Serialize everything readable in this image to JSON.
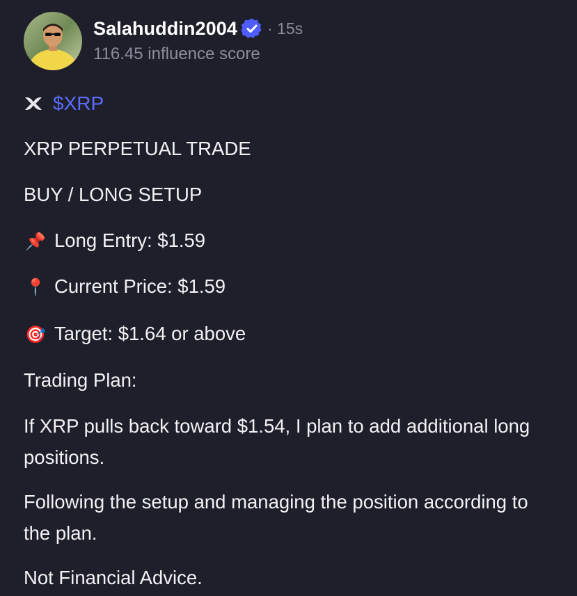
{
  "author": {
    "username": "Salahuddin2004",
    "verified": true,
    "time_ago": "· 15s",
    "influence_score": "116.45 influence score"
  },
  "post": {
    "cashtag": "$XRP",
    "cashtag_icon": "xrp-logo-icon",
    "title": "XRP PERPETUAL TRADE",
    "setup": "BUY / LONG SETUP",
    "entry": {
      "icon": "pushpin-icon",
      "glyph": "📌",
      "text": "Long Entry: $1.59"
    },
    "current": {
      "icon": "round-pin-icon",
      "glyph": "📍",
      "text": "Current Price: $1.59"
    },
    "target": {
      "icon": "target-icon",
      "glyph": "🎯",
      "text": "Target: $1.64 or above"
    },
    "plan_heading": "Trading Plan:",
    "plan_text": "If XRP pulls back toward $1.54, I plan to add additional long positions.",
    "follow_text": "Following the setup and managing the position according to the plan.",
    "disclaimer": "Not Financial Advice."
  },
  "colors": {
    "background": "#1f1f2b",
    "cashtag": "#5b6cff",
    "verified_badge": "#4f5dff",
    "muted_text": "#8b8d9c"
  }
}
